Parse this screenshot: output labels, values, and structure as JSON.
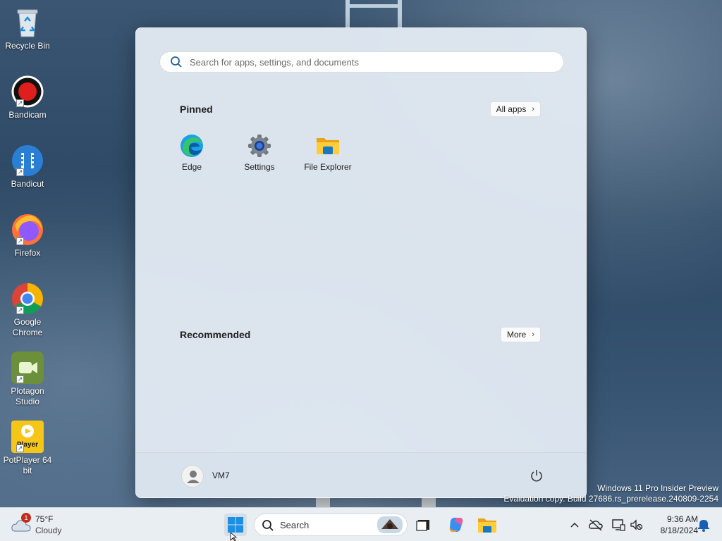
{
  "desktop": {
    "icons": [
      {
        "label": "Recycle Bin"
      },
      {
        "label": "Bandicam"
      },
      {
        "label": "Bandicut"
      },
      {
        "label": "Firefox"
      },
      {
        "label": "Google Chrome"
      },
      {
        "label": "Plotagon Studio"
      },
      {
        "label": "PotPlayer 64 bit",
        "glyph_text": "Player"
      }
    ]
  },
  "start_menu": {
    "search_placeholder": "Search for apps, settings, and documents",
    "pinned_title": "Pinned",
    "all_apps_label": "All apps",
    "pinned_apps": [
      {
        "label": "Edge",
        "icon": "edge-icon"
      },
      {
        "label": "Settings",
        "icon": "gear-icon"
      },
      {
        "label": "File Explorer",
        "icon": "folder-icon"
      }
    ],
    "recommended_title": "Recommended",
    "more_label": "More",
    "user_name": "VM7"
  },
  "watermark": {
    "line1": "Windows 11 Pro Insider Preview",
    "line2": "Evaluation copy. Build 27686.rs_prerelease.240809-2254"
  },
  "taskbar": {
    "weather": {
      "temp": "75°F",
      "condition": "Cloudy",
      "badge": "1"
    },
    "search_label": "Search",
    "time": "9:36 AM",
    "date": "8/18/2024"
  },
  "colors": {
    "accent": "#0067c0",
    "taskbar_bg": "#e9eef3",
    "start_bg": "#e2eaf2"
  }
}
